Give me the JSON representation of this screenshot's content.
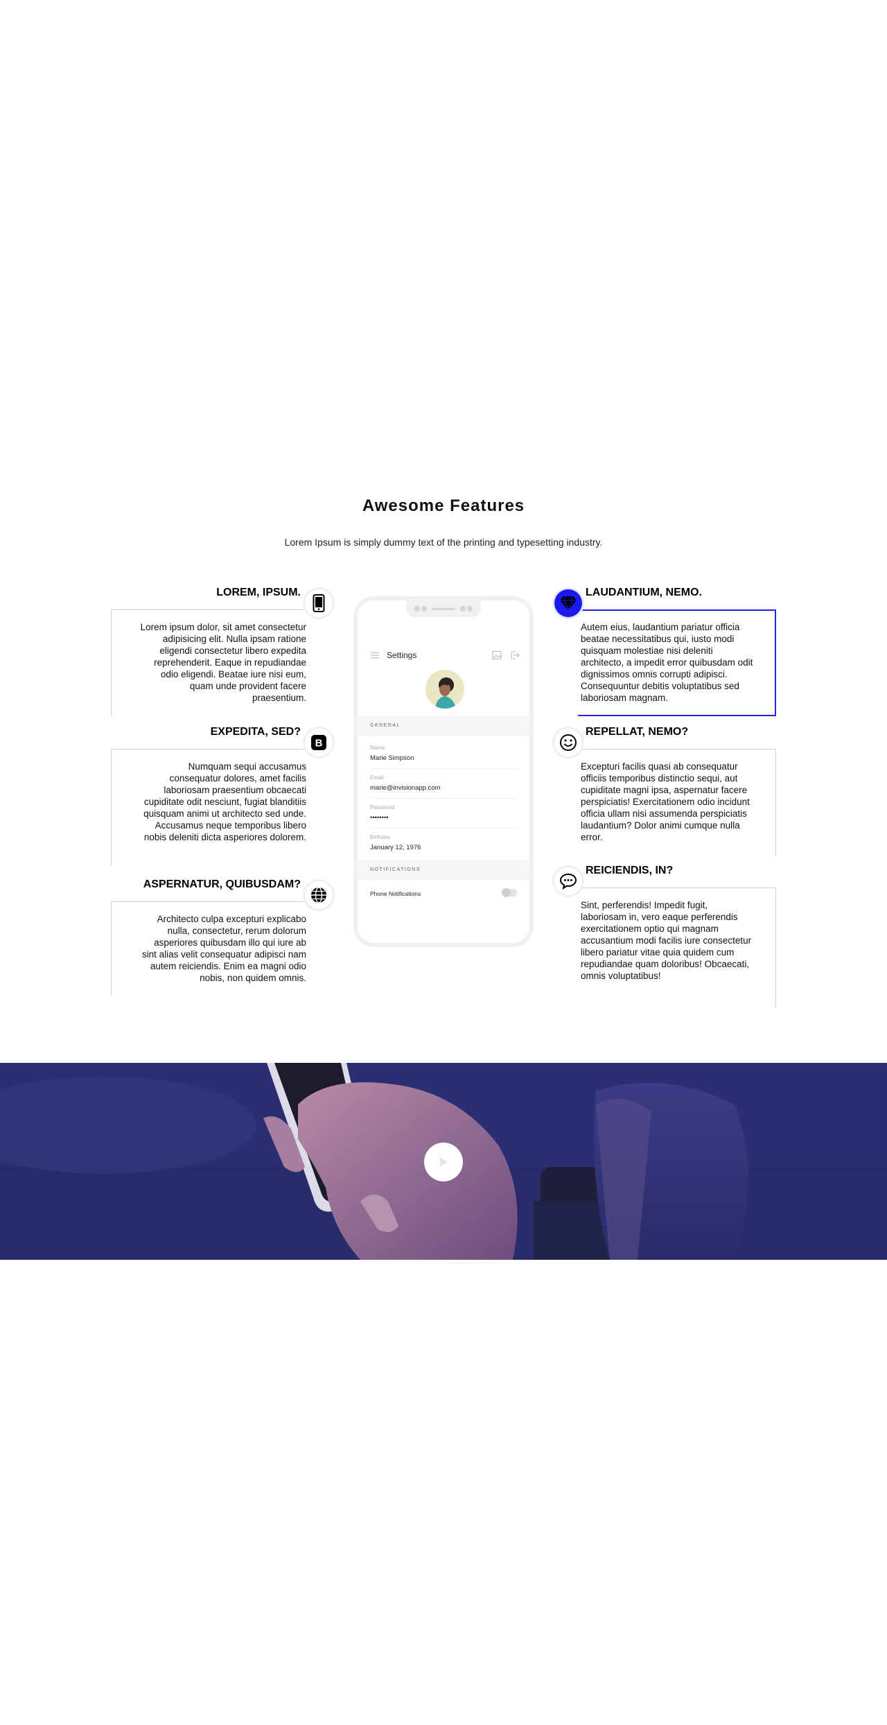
{
  "features_section": {
    "title": "Awesome Features",
    "subtitle": "Lorem Ipsum is simply dummy text of the printing and typesetting industry."
  },
  "left_features": [
    {
      "title": "LOREM, IPSUM.",
      "icon": "mobile-phone-icon",
      "text": "Lorem ipsum dolor, sit amet consectetur adipisicing elit. Nulla ipsam ratione eligendi consectetur libero expedita reprehenderit. Eaque in repudiandae odio eligendi. Beatae iure nisi eum, quam unde provident facere praesentium."
    },
    {
      "title": "EXPEDITA, SED?",
      "icon": "bootstrap-icon",
      "text": "Numquam sequi accusamus consequatur dolores, amet facilis laboriosam praesentium obcaecati cupiditate odit nesciunt, fugiat blanditiis quisquam animi ut architecto sed unde. Accusamus neque temporibus libero nobis deleniti dicta asperiores dolorem."
    },
    {
      "title": "ASPERNATUR, QUIBUSDAM?",
      "icon": "globe-icon",
      "text": "Architecto culpa excepturi explicabo nulla, consectetur, rerum dolorum asperiores quibusdam illo qui iure ab sint alias velit consequatur adipisci nam autem reiciendis. Enim ea magni odio nobis, non quidem omnis."
    }
  ],
  "right_features": [
    {
      "title": "LAUDANTIUM, NEMO.",
      "icon": "diamond-icon",
      "active": true,
      "text": "Autem eius, laudantium pariatur officia beatae necessitatibus qui, iusto modi quisquam molestiae nisi deleniti architecto, a impedit error quibusdam odit dignissimos omnis corrupti adipisci. Consequuntur debitis voluptatibus sed laboriosam magnam."
    },
    {
      "title": "REPELLAT, NEMO?",
      "icon": "smiley-icon",
      "active": false,
      "text": "Excepturi facilis quasi ab consequatur officiis temporibus distinctio sequi, aut cupiditate magni ipsa, aspernatur facere perspiciatis! Exercitationem odio incidunt officia ullam nisi assumenda perspiciatis laudantium? Dolor animi cumque nulla error."
    },
    {
      "title": "REICIENDIS, IN?",
      "icon": "chat-bubble-icon",
      "active": false,
      "text": "Sint, perferendis! Impedit fugit, laboriosam in, vero eaque perferendis exercitationem optio qui magnam accusantium modi facilis iure consectetur libero pariatur vitae quia quidem cum repudiandae quam doloribus! Obcaecati, omnis voluptatibus!"
    }
  ],
  "phone": {
    "screen_title": "Settings",
    "general_label": "GENERAL",
    "fields": [
      {
        "label": "Name",
        "value": "Marie Simpson"
      },
      {
        "label": "Email",
        "value": "marie@invisionapp.com"
      },
      {
        "label": "Password",
        "value": "••••••••"
      },
      {
        "label": "Birthday",
        "value": "January 12, 1976"
      }
    ],
    "notifications_label": "NOTIFICATIONS",
    "phone_notifications_label": "Phone Notifications",
    "phone_notifications_on": false
  },
  "video": {
    "play_icon": "play-icon",
    "accent_color": "#2b2e72"
  },
  "colors": {
    "accent": "#1a1aee",
    "border": "#d0d0d0"
  }
}
